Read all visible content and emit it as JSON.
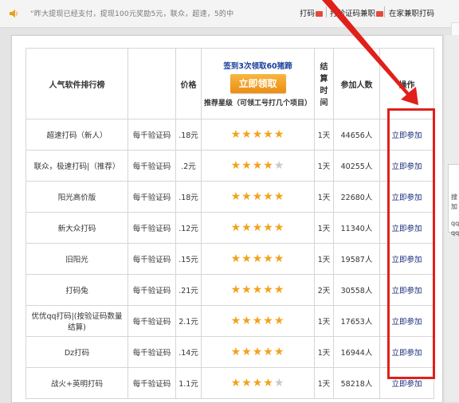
{
  "topbar": {
    "ticker": "“昨大提现已经支付，提现100元奖励5元，联众，超速，5的中",
    "links": [
      "打码",
      "打验证码兼职",
      "在家兼职打码"
    ]
  },
  "table": {
    "headers": {
      "name": "人气软件排行榜",
      "price": "价格",
      "promo_title": "签到3次领取60猪蹄",
      "promo_button": "立即领取",
      "promo_note": "推荐星级（可领工号打几个项目）",
      "settle": "结算时间",
      "people": "参加人数",
      "action": "操作"
    },
    "rows": [
      {
        "name": "超速打码（新人）",
        "unit": "每千验证码",
        "price": ".18元",
        "stars": 5,
        "settle": "1天",
        "people": "44656人",
        "action": "立即参加"
      },
      {
        "name": "联众，极速打码|（推荐）",
        "unit": "每千验证码",
        "price": ".2元",
        "stars": 4,
        "settle": "1天",
        "people": "40255人",
        "action": "立即参加"
      },
      {
        "name": "阳光高价版",
        "unit": "每千验证码",
        "price": ".18元",
        "stars": 5,
        "settle": "1天",
        "people": "22680人",
        "action": "立即参加"
      },
      {
        "name": "新大众打码",
        "unit": "每千验证码",
        "price": ".12元",
        "stars": 5,
        "settle": "1天",
        "people": "11340人",
        "action": "立即参加"
      },
      {
        "name": "旧阳光",
        "unit": "每千验证码",
        "price": ".15元",
        "stars": 5,
        "settle": "1天",
        "people": "19587人",
        "action": "立即参加"
      },
      {
        "name": "打码兔",
        "unit": "每千验证码",
        "price": ".21元",
        "stars": 5,
        "settle": "2天",
        "people": "30558人",
        "action": "立即参加"
      },
      {
        "name": "优优qq打码|(按验证码数量结算)",
        "unit": "每千验证码",
        "price": "2.1元",
        "stars": 5,
        "settle": "1天",
        "people": "17653人",
        "action": "立即参加"
      },
      {
        "name": "Dz打码",
        "unit": "每千验证码",
        "price": ".14元",
        "stars": 5,
        "settle": "1天",
        "people": "16944人",
        "action": "立即参加"
      },
      {
        "name": "战火+英明打码",
        "unit": "每千验证码",
        "price": "1.1元",
        "stars": 4,
        "settle": "1天",
        "people": "58218人",
        "action": "立即参加"
      }
    ]
  },
  "sidebar": {
    "text1": "搜",
    "text2": "加",
    "text3": "qq",
    "text4": "qq"
  },
  "colors": {
    "highlight": "#e0201a",
    "star": "#f3a21b",
    "promo_button": "#ec8d12",
    "link": "#1a2c7a"
  }
}
